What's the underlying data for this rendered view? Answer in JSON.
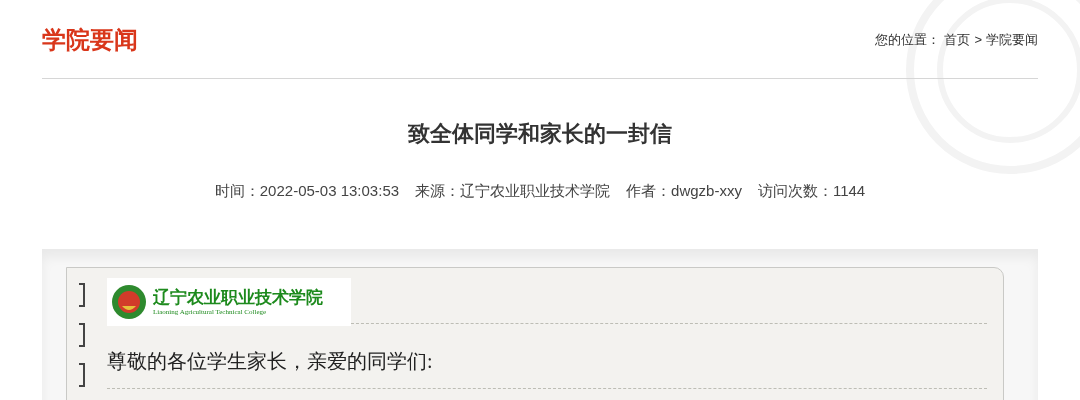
{
  "section_title": "学院要闻",
  "breadcrumb": {
    "label": "您的位置：",
    "separator": ">",
    "links": [
      "首页",
      "学院要闻"
    ]
  },
  "article": {
    "title": "致全体同学和家长的一封信",
    "meta": [
      "时间：2022-05-03 13:03:53",
      "来源：辽宁农业职业技术学院",
      "作者：dwgzb-xxy",
      "访问次数：1144"
    ]
  },
  "letter": {
    "logo_name": "辽宁农业职业技术学院",
    "logo_subtitle": "Liaoning Agricultural Technical College",
    "greeting": "尊敬的各位学生家长，亲爱的同学们:"
  }
}
